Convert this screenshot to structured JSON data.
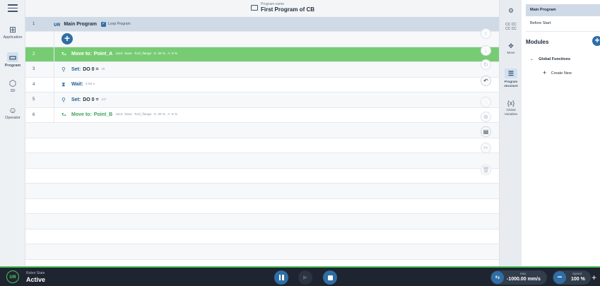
{
  "nav": {
    "items": [
      {
        "label": "Application",
        "icon": "grid-icon"
      },
      {
        "label": "Program",
        "icon": "program-icon",
        "active": true
      },
      {
        "label": "3D",
        "icon": "cube-icon"
      },
      {
        "label": "Operator",
        "icon": "person-icon"
      }
    ]
  },
  "header": {
    "program_name_label": "Program name",
    "program_name": "First Program of CB"
  },
  "program": {
    "header": {
      "num": "1",
      "title": "Main Program",
      "loop_label": "Loop Program",
      "loop_checked": true
    },
    "rows": [
      {
        "num": "2",
        "cmd": "Move to:",
        "target": "Point_A",
        "details": [
          "Joint",
          "base",
          "Tool_flange",
          "S: 30 %",
          "A: 9 %"
        ],
        "selected": true,
        "type": "move"
      },
      {
        "num": "3",
        "cmd": "Set:",
        "target": "DO 0 =",
        "details": [
          "HI"
        ],
        "type": "set"
      },
      {
        "num": "4",
        "cmd": "Wait:",
        "target": "",
        "details": [
          "3.00 s"
        ],
        "type": "wait"
      },
      {
        "num": "5",
        "cmd": "Set:",
        "target": "DO 0 =",
        "details": [
          "LO"
        ],
        "type": "set"
      },
      {
        "num": "6",
        "cmd": "Move to:",
        "target": "Point_B",
        "details": [
          "Joint",
          "base",
          "Tool_flange",
          "S: 30 %",
          "A: 9 %"
        ],
        "type": "move"
      }
    ]
  },
  "tools": {
    "items": [
      {
        "label": "",
        "icon": "robot-arm-icon"
      },
      {
        "label": "",
        "icon": "code-icon"
      },
      {
        "label": "Move",
        "icon": "move-icon"
      },
      {
        "label": "Program structure",
        "icon": "list-icon",
        "active": true
      },
      {
        "label": "Global Variables",
        "icon": "variable-icon"
      }
    ]
  },
  "right_panel": {
    "main_program": "Main Program",
    "before_start": "Before Start",
    "modules_title": "Modules",
    "global_functions": "Global Functions",
    "create_new": "Create New"
  },
  "bottom": {
    "robot_state_label": "Robot State",
    "robot_state": "Active",
    "max_label": "Max",
    "max_value": "-1000.00 mm/s",
    "speed_label": "Speed",
    "speed_value": "100 %"
  },
  "colors": {
    "accent": "#2f6ea5",
    "selected_row": "#77cc73",
    "status_green": "#4fbf5a",
    "bottom_bar": "#1e2530"
  }
}
